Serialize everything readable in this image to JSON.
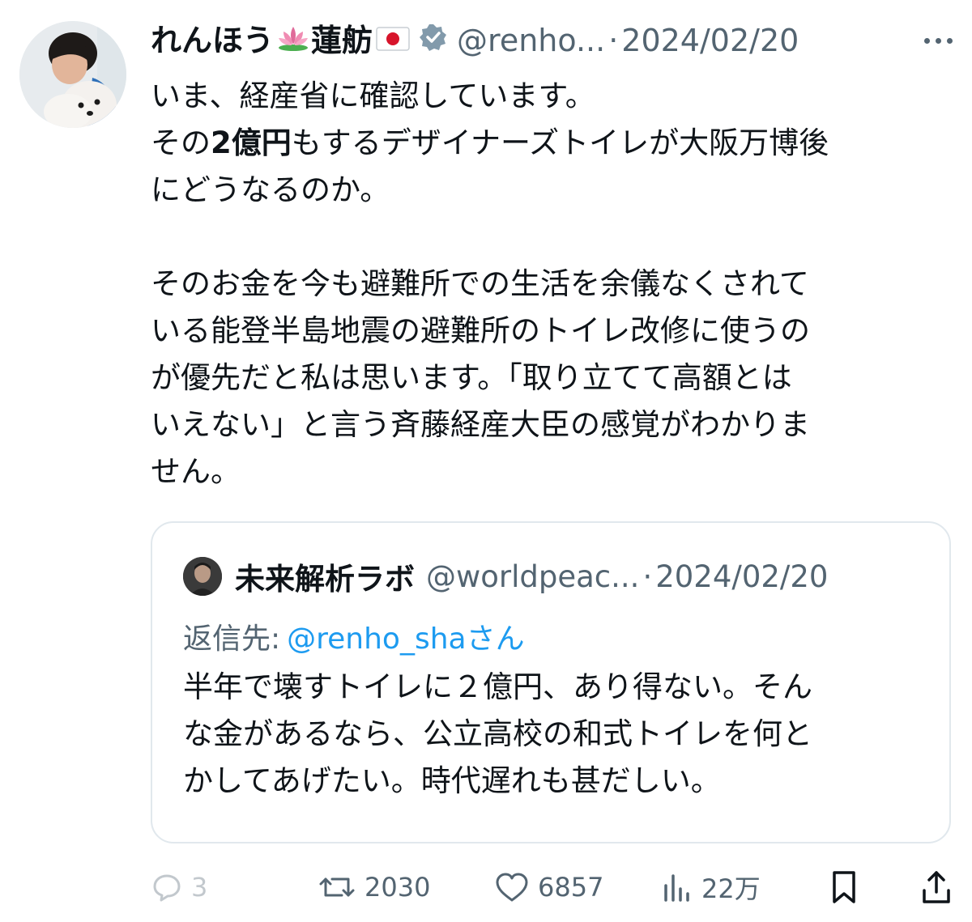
{
  "tweet": {
    "author": {
      "display_name": "れんほう",
      "name_kanji": "蓮舫",
      "handle": "@renho...",
      "avatar_icon": "profile-photo-woman-with-dog"
    },
    "separator": "·",
    "date": "2024/02/20",
    "text_line1": "いま、経産省に確認しています。",
    "text_line2_prefix": "その",
    "text_line2_bold": "2億円",
    "text_line2_suffix": "もするデザイナーズトイレが大阪万博後",
    "text_line3": "にどうなるのか。",
    "text_paragraph2": "そのお金を今も避難所での生活を余儀なくされて\nいる能登半島地震の避難所のトイレ改修に使うの\nが優先だと私は思います。「取り立てて高額とは\nいえない」と言う斉藤経産大臣の感覚がわかりま\nせん。"
  },
  "quote": {
    "author": {
      "display_name": "未来解析ラボ",
      "handle": "@worldpeac..."
    },
    "separator": "·",
    "date": "2024/02/20",
    "reply_label": "返信先:",
    "reply_mention": "@renho_sha",
    "reply_suffix": "さん",
    "text": "半年で壊すトイレに２億円、あり得ない。そん\nな金があるなら、公立高校の和式トイレを何と\nかしてあげたい。時代遅れも甚だしい。"
  },
  "actions": {
    "reply_count": "3",
    "retweet_count": "2030",
    "like_count": "6857",
    "views_count": "22万"
  },
  "colors": {
    "text": "#0f1419",
    "secondary": "#536471",
    "link": "#1d9bf0",
    "border": "#e1e8ed",
    "verified": "#829aab"
  }
}
